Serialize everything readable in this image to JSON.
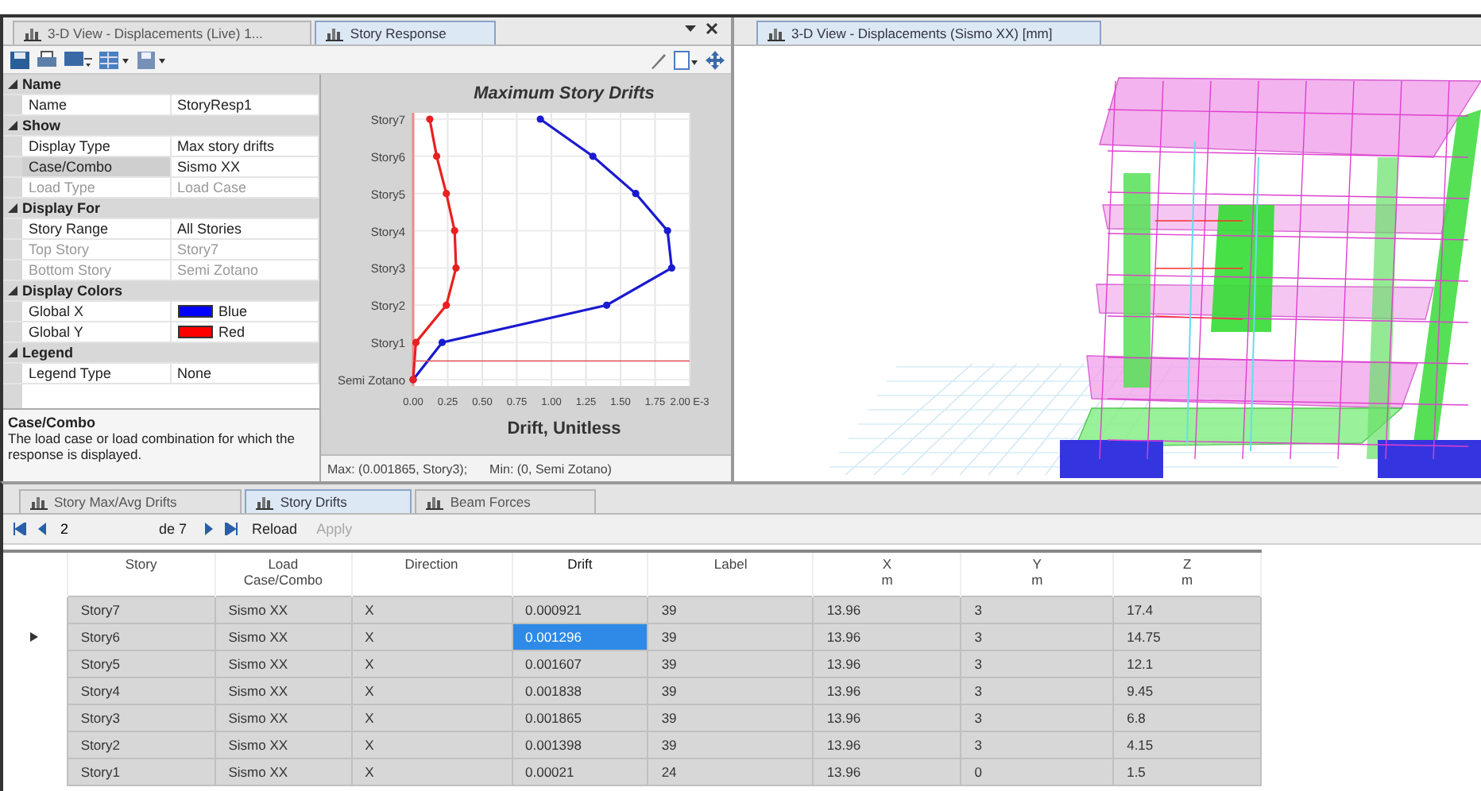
{
  "top_left_pane": {
    "tabs": [
      {
        "label": "3-D View - Displacements (Live) 1...",
        "selected": false
      },
      {
        "label": "Story Response",
        "selected": true
      }
    ],
    "properties": [
      {
        "category": "Name",
        "expanded": true,
        "items": [
          {
            "kind": "text",
            "name": "Name",
            "value": "StoryResp1",
            "disabled": false,
            "selected": false
          }
        ]
      },
      {
        "category": "Show",
        "expanded": true,
        "items": [
          {
            "kind": "text",
            "name": "Display Type",
            "value": "Max story drifts",
            "disabled": false,
            "selected": false
          },
          {
            "kind": "text",
            "name": "Case/Combo",
            "value": "Sismo XX",
            "disabled": false,
            "selected": true
          },
          {
            "kind": "text",
            "name": "Load Type",
            "value": "Load Case",
            "disabled": true,
            "selected": false
          }
        ]
      },
      {
        "category": "Display For",
        "expanded": true,
        "items": [
          {
            "kind": "text",
            "name": "Story Range",
            "value": "All Stories",
            "disabled": false,
            "selected": false
          },
          {
            "kind": "text",
            "name": "Top Story",
            "value": "Story7",
            "disabled": true,
            "selected": false
          },
          {
            "kind": "text",
            "name": "Bottom Story",
            "value": "Semi Zotano",
            "disabled": true,
            "selected": false
          }
        ]
      },
      {
        "category": "Display Colors",
        "expanded": true,
        "items": [
          {
            "kind": "color",
            "name": "Global X",
            "value": "Blue",
            "color": "#0000ff",
            "disabled": false,
            "selected": false
          },
          {
            "kind": "color",
            "name": "Global Y",
            "value": "Red",
            "color": "#ff0000",
            "disabled": false,
            "selected": false
          }
        ]
      },
      {
        "category": "Legend",
        "expanded": true,
        "items": [
          {
            "kind": "text",
            "name": "Legend Type",
            "value": "None",
            "disabled": false,
            "selected": false
          }
        ]
      }
    ],
    "description": {
      "title": "Case/Combo",
      "text": "The load case or load combination for which the response is displayed."
    },
    "chart": {
      "chart_data": {
        "type": "line",
        "orientation": "horizontal",
        "title": "Maximum Story Drifts",
        "xlabel": "Drift, Unitless",
        "categories": [
          "Story7",
          "Story6",
          "Story5",
          "Story4",
          "Story3",
          "Story2",
          "Story1",
          "Semi Zotano"
        ],
        "series": [
          {
            "color": "#1a1ad0",
            "marker": "circle",
            "values": [
              0.92,
              1.3,
              1.61,
              1.84,
              1.87,
              1.4,
              0.21,
              0
            ]
          },
          {
            "color": "#e82020",
            "marker": "circle",
            "values": [
              0.12,
              0.17,
              0.24,
              0.3,
              0.31,
              0.24,
              0.02,
              0
            ]
          }
        ],
        "grid": true,
        "xlim": [
          0,
          2
        ],
        "xticks": [
          {
            "value": 0,
            "label": "0.00"
          },
          {
            "value": 0.25,
            "label": "0.25"
          },
          {
            "value": 0.5,
            "label": "0.50"
          },
          {
            "value": 0.75,
            "label": "0.75"
          },
          {
            "value": 1,
            "label": "1.00"
          },
          {
            "value": 1.25,
            "label": "1.25"
          },
          {
            "value": 1.5,
            "label": "1.50"
          },
          {
            "value": 1.75,
            "label": "1.75"
          },
          {
            "value": 2,
            "label": "2.00 E-3"
          }
        ]
      }
    },
    "chart_footer": {
      "max": "Max: (0.001865, Story3);",
      "min": "Min: (0, Semi Zotano)"
    }
  },
  "right_pane": {
    "tabs": [
      {
        "label": "3-D View - Displacements (Sismo XX) [mm]",
        "selected": true
      }
    ]
  },
  "bottom_panel": {
    "tabs": [
      {
        "label": "Story Max/Avg Drifts",
        "selected": false
      },
      {
        "label": "Story Drifts",
        "selected": true
      },
      {
        "label": "Beam Forces",
        "selected": false
      }
    ],
    "navigator": {
      "record": "2",
      "of_label": "de 7",
      "buttons": [
        {
          "label": "Reload",
          "disabled": false
        },
        {
          "label": "Apply",
          "disabled": true
        }
      ]
    },
    "table": {
      "columns": [
        {
          "label": "Story",
          "current": false
        },
        {
          "label": "Load Case/Combo",
          "current": false
        },
        {
          "label": "Direction",
          "current": false
        },
        {
          "label": "Drift",
          "current": true
        },
        {
          "label": "Label",
          "current": false
        },
        {
          "label": "X",
          "unit": "m",
          "current": false
        },
        {
          "label": "Y",
          "unit": "m",
          "current": false
        },
        {
          "label": "Z",
          "unit": "m",
          "current": false
        }
      ],
      "rows": [
        {
          "selected": false,
          "cells": [
            "Story7",
            "Sismo XX",
            "X",
            "0.000921",
            "39",
            "13.96",
            "3",
            "17.4"
          ]
        },
        {
          "selected": true,
          "cells": [
            "Story6",
            "Sismo XX",
            "X",
            "0.001296",
            "39",
            "13.96",
            "3",
            "14.75"
          ]
        },
        {
          "selected": false,
          "cells": [
            "Story5",
            "Sismo XX",
            "X",
            "0.001607",
            "39",
            "13.96",
            "3",
            "12.1"
          ]
        },
        {
          "selected": false,
          "cells": [
            "Story4",
            "Sismo XX",
            "X",
            "0.001838",
            "39",
            "13.96",
            "3",
            "9.45"
          ]
        },
        {
          "selected": false,
          "cells": [
            "Story3",
            "Sismo XX",
            "X",
            "0.001865",
            "39",
            "13.96",
            "3",
            "6.8"
          ]
        },
        {
          "selected": false,
          "cells": [
            "Story2",
            "Sismo XX",
            "X",
            "0.001398",
            "39",
            "13.96",
            "3",
            "4.15"
          ]
        },
        {
          "selected": false,
          "cells": [
            "Story1",
            "Sismo XX",
            "X",
            "0.00021",
            "24",
            "13.96",
            "0",
            "1.5"
          ]
        }
      ]
    }
  }
}
